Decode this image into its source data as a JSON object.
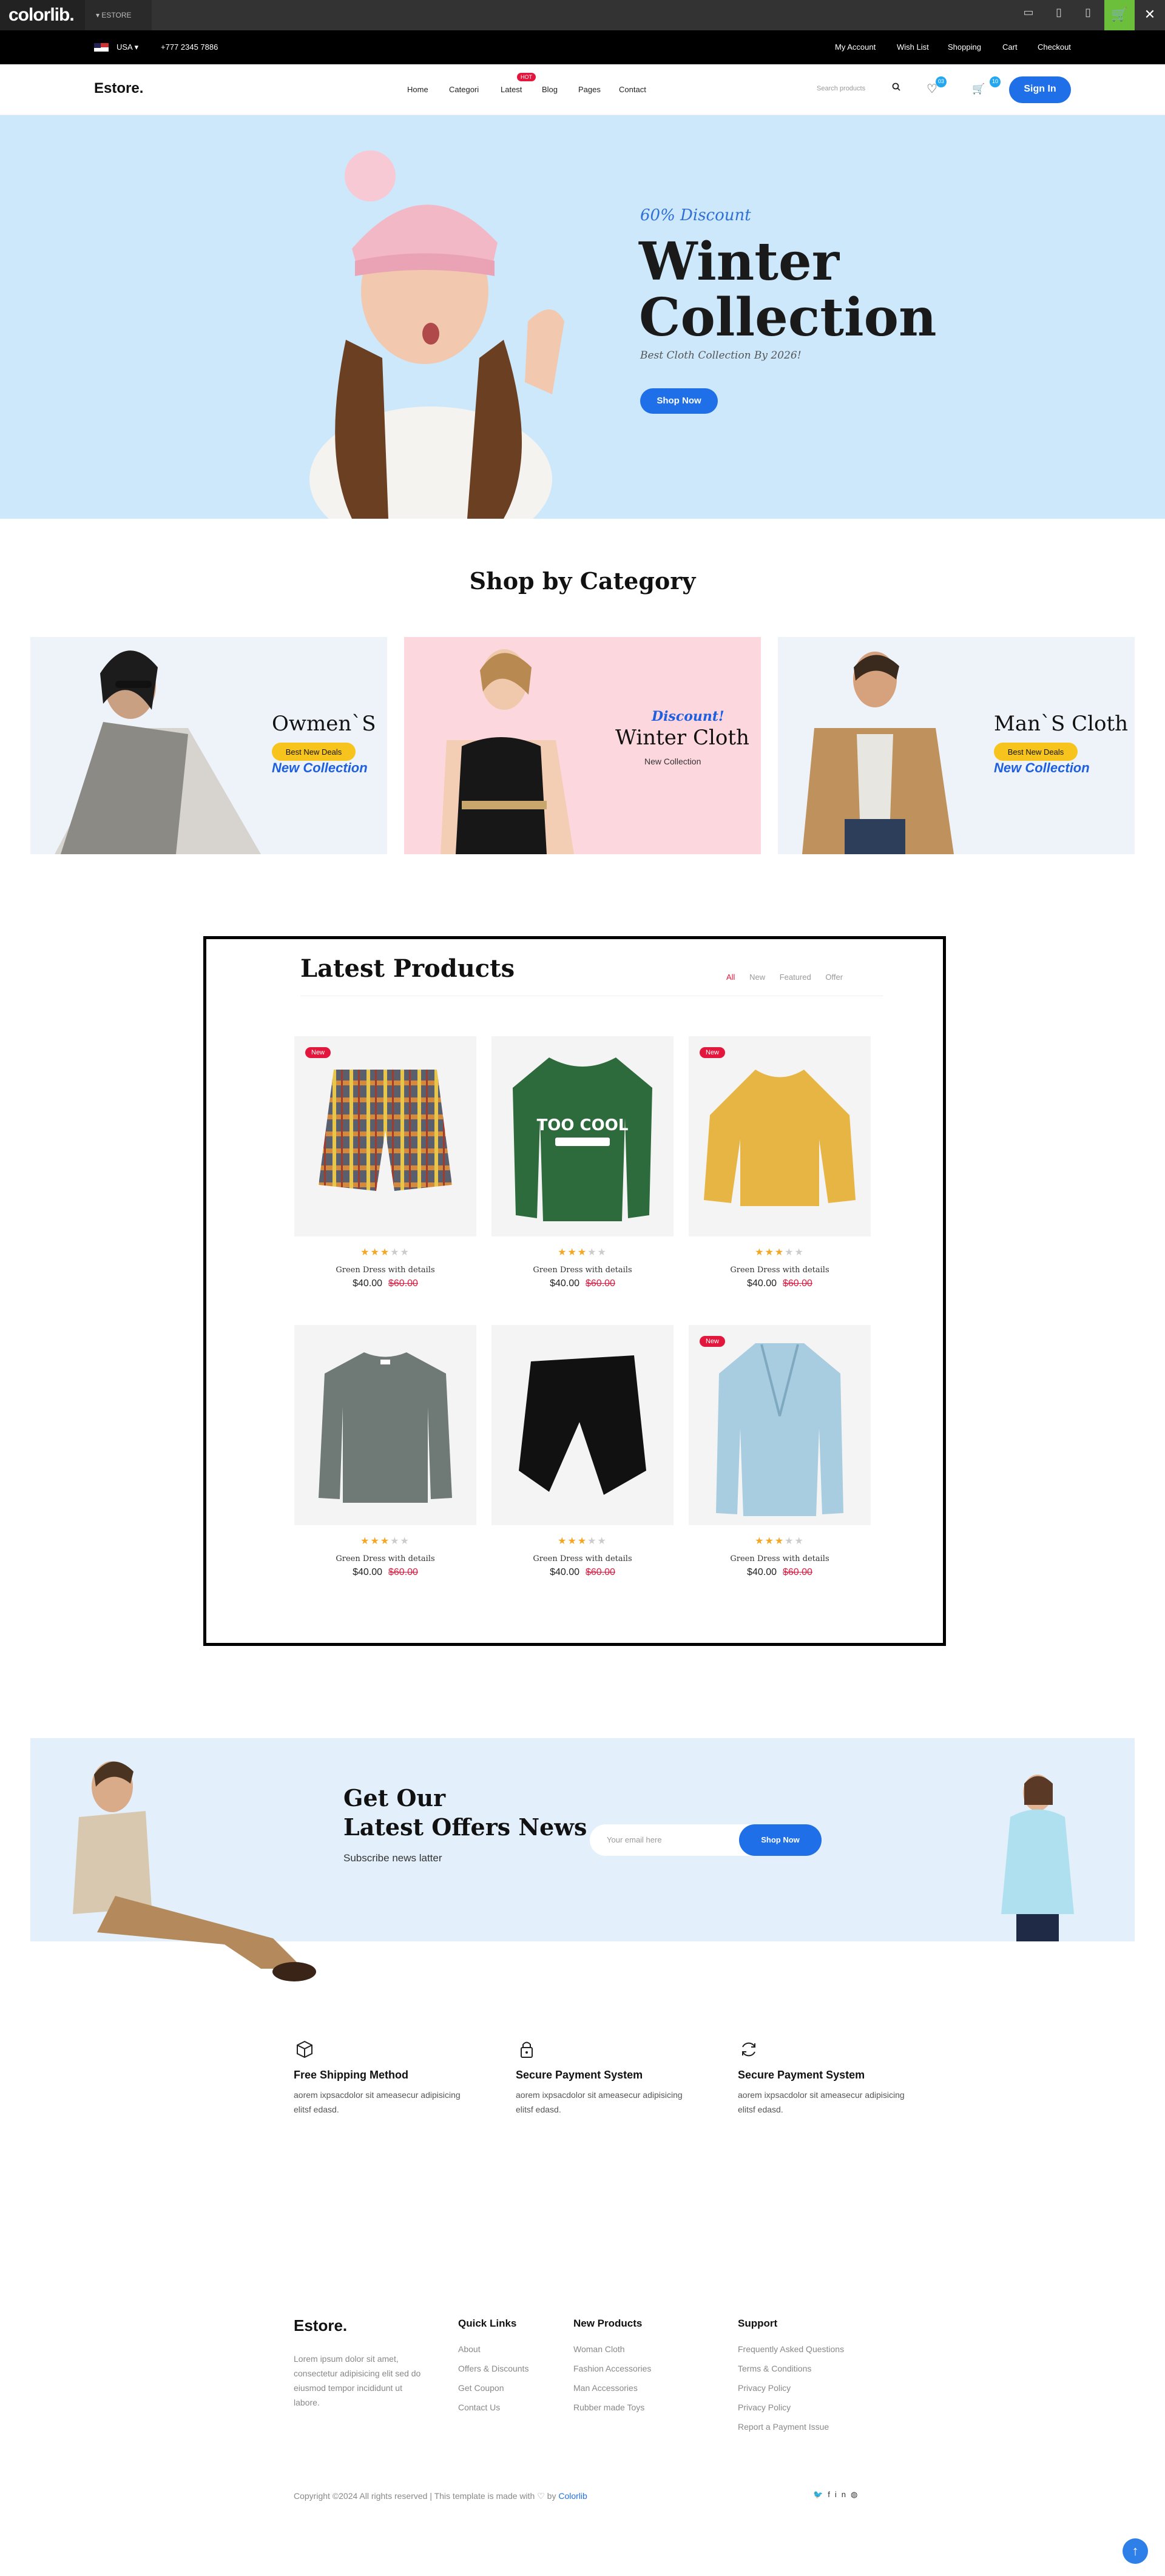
{
  "browser_bar": {
    "brand": "colorlib.",
    "tab": "ESTORE"
  },
  "topbar": {
    "country": "USA",
    "phone": "+777 2345 7886",
    "links": [
      "My Account",
      "Wish List",
      "Shopping",
      "Cart",
      "Checkout"
    ]
  },
  "nav": {
    "logo": "Estore.",
    "items": [
      "Home",
      "Categori",
      "Latest",
      "Blog",
      "Pages",
      "Contact"
    ],
    "hot_label": "HOT",
    "search_placeholder": "Search products",
    "wishlist_count": "03",
    "cart_count": "10",
    "signin": "Sign In"
  },
  "hero": {
    "discount": "60% Discount",
    "title_line1": "Winter",
    "title_line2": "Collection",
    "subtitle": "Best Cloth Collection By 2026!",
    "button": "Shop Now"
  },
  "categories": {
    "heading": "Shop by Category",
    "items": [
      {
        "name": "Owmen`S",
        "pill": "Best New Deals",
        "script": "New Collection"
      },
      {
        "script": "Discount!",
        "name": "Winter Cloth",
        "sub": "New Collection"
      },
      {
        "name": "Man`S Cloth",
        "pill": "Best New Deals",
        "script": "New Collection"
      }
    ]
  },
  "latest": {
    "heading": "Latest Products",
    "tabs": [
      "All",
      "New",
      "Featured",
      "Offer"
    ],
    "new_label": "New",
    "products": [
      {
        "name": "Green Dress with details",
        "price": "$40.00",
        "old_price": "$60.00",
        "rating": 3,
        "is_new": true
      },
      {
        "name": "Green Dress with details",
        "price": "$40.00",
        "old_price": "$60.00",
        "rating": 3,
        "is_new": false
      },
      {
        "name": "Green Dress with details",
        "price": "$40.00",
        "old_price": "$60.00",
        "rating": 3,
        "is_new": true
      },
      {
        "name": "Green Dress with details",
        "price": "$40.00",
        "old_price": "$60.00",
        "rating": 3,
        "is_new": false
      },
      {
        "name": "Green Dress with details",
        "price": "$40.00",
        "old_price": "$60.00",
        "rating": 3,
        "is_new": false
      },
      {
        "name": "Green Dress with details",
        "price": "$40.00",
        "old_price": "$60.00",
        "rating": 3,
        "is_new": true
      }
    ],
    "sweater_text": "TOO COOL"
  },
  "newsletter": {
    "title_line1": "Get Our",
    "title_line2": "Latest Offers News",
    "subtitle": "Subscribe news latter",
    "placeholder": "Your email here",
    "button": "Shop Now"
  },
  "features": [
    {
      "icon": "box-icon",
      "title": "Free Shipping Method",
      "desc": "aorem ixpsacdolor sit ameasecur adipisicing elitsf edasd."
    },
    {
      "icon": "lock-icon",
      "title": "Secure Payment System",
      "desc": "aorem ixpsacdolor sit ameasecur adipisicing elitsf edasd."
    },
    {
      "icon": "refresh-icon",
      "title": "Secure Payment System",
      "desc": "aorem ixpsacdolor sit ameasecur adipisicing elitsf edasd."
    }
  ],
  "footer": {
    "logo": "Estore.",
    "desc": "Lorem ipsum dolor sit amet, consectetur adipisicing elit sed do eiusmod tempor incididunt ut labore.",
    "columns": [
      {
        "title": "Quick Links",
        "links": [
          "About",
          "Offers & Discounts",
          "Get Coupon",
          "Contact Us"
        ]
      },
      {
        "title": "New Products",
        "links": [
          "Woman Cloth",
          "Fashion Accessories",
          "Man Accessories",
          "Rubber made Toys"
        ]
      },
      {
        "title": "Support",
        "links": [
          "Frequently Asked Questions",
          "Terms & Conditions",
          "Privacy Policy",
          "Privacy Policy",
          "Report a Payment Issue"
        ]
      }
    ],
    "copyright_before": "Copyright ©2024 All rights reserved | This template is made with",
    "copyright_by": "by",
    "copyright_link": "Colorlib"
  },
  "colors": {
    "accent": "#1e6fe8",
    "hot": "#e3173d",
    "hero_bg": "#cde8fa",
    "star": "#f5a623",
    "pill": "#f7c41e"
  }
}
